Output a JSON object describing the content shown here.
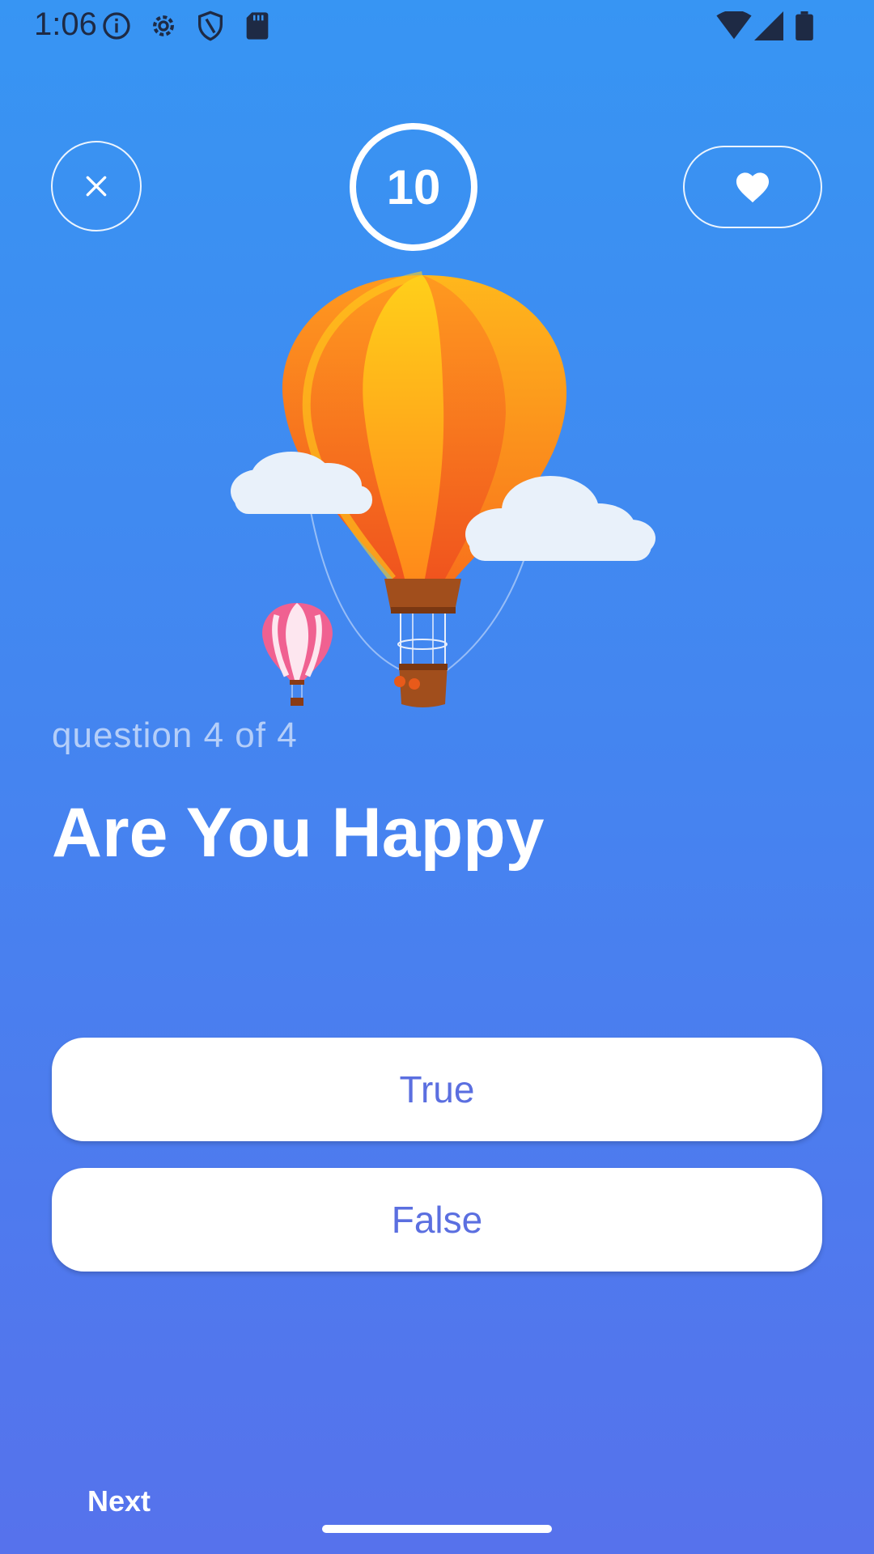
{
  "status_bar": {
    "time": "1:06",
    "icons_left": [
      "info-icon",
      "gear-icon",
      "shield-icon",
      "sd-card-icon"
    ],
    "icons_right": [
      "wifi-icon",
      "signal-icon",
      "battery-icon"
    ]
  },
  "header": {
    "close_icon": "close-icon",
    "timer_value": "10",
    "favorite_icon": "heart-icon"
  },
  "quiz": {
    "progress": "question 4 of 4",
    "question": "Are You Happy",
    "answers": [
      "True",
      "False"
    ]
  },
  "footer": {
    "next_label": "Next"
  },
  "colors": {
    "background_top": "#3795f3",
    "background_bottom": "#5672ec",
    "answer_text": "#5b6fe0",
    "white": "#ffffff"
  }
}
